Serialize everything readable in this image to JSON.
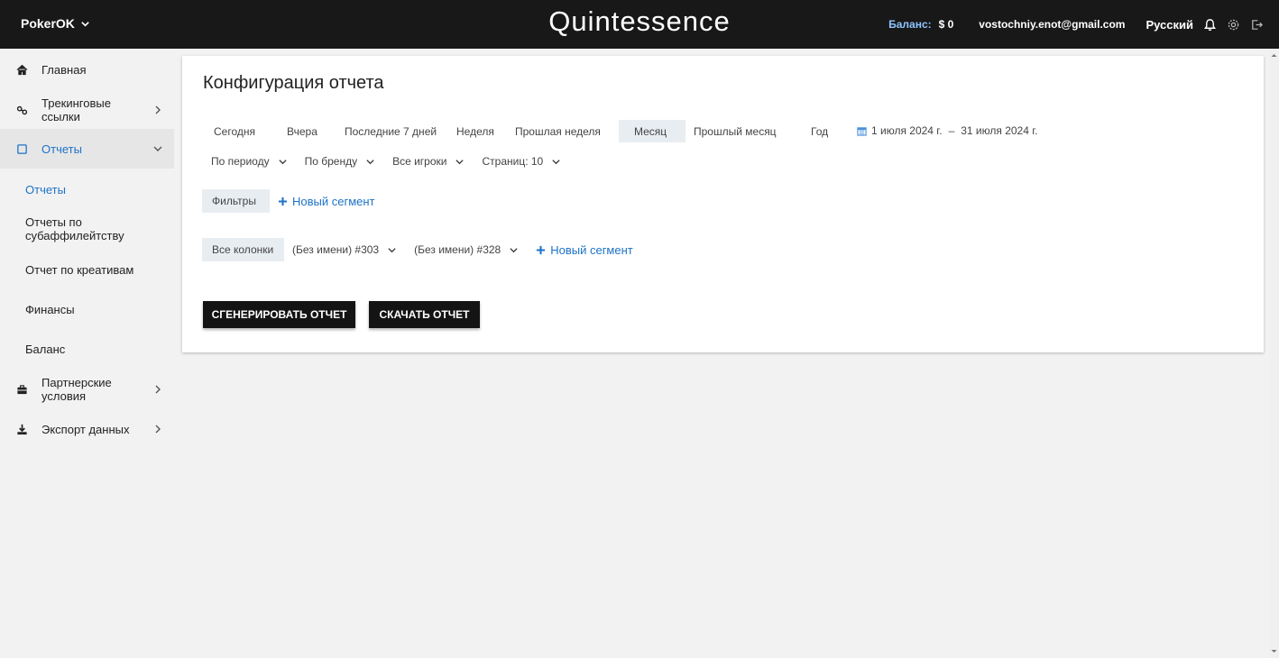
{
  "header": {
    "brand": "PokerOK",
    "logo": "Quintessence",
    "balance_label": "Баланс:",
    "balance_value": "$ 0",
    "email": "vostochniy.enot@gmail.com",
    "language": "Русский"
  },
  "sidebar": {
    "items": [
      {
        "label": "Главная",
        "icon": "home-icon"
      },
      {
        "label": "Трекинговые ссылки",
        "icon": "link-icon"
      },
      {
        "label": "Отчеты",
        "icon": "report-icon"
      },
      {
        "label": "Партнерские условия",
        "icon": "briefcase-icon"
      },
      {
        "label": "Экспорт данных",
        "icon": "download-icon"
      }
    ],
    "sub_items": [
      {
        "label": "Отчеты"
      },
      {
        "label": "Отчеты по субаффилейтству"
      },
      {
        "label": "Отчет по креативам"
      },
      {
        "label": "Финансы"
      },
      {
        "label": "Баланс"
      }
    ]
  },
  "main": {
    "title": "Конфигурация отчета",
    "periods": [
      "Сегодня",
      "Вчера",
      "Последние 7 дней",
      "Неделя",
      "Прошлая неделя",
      "Месяц",
      "Прошлый месяц",
      "Год"
    ],
    "active_period": "Месяц",
    "date_from": "1 июля 2024 г.",
    "date_sep": "–",
    "date_to": "31 июля 2024 г.",
    "dropdowns": [
      "По периоду",
      "По бренду",
      "Все игроки",
      "Страниц: 10"
    ],
    "filters_label": "Фильтры",
    "new_segment_label": "Новый сегмент",
    "columns_label": "Все колонки",
    "column_segments": [
      "(Без имени) #303",
      "(Без имени) #328"
    ],
    "new_segment_label_2": "Новый сегмент",
    "generate_button": "СГЕНЕРИРОВАТЬ ОТЧЕТ",
    "download_button": "СКАЧАТЬ ОТЧЕТ"
  },
  "colors": {
    "accent": "#1e73c8",
    "topbar": "#181818",
    "balance_label": "#8ec5ff",
    "pill_bg": "#e8edf2"
  }
}
